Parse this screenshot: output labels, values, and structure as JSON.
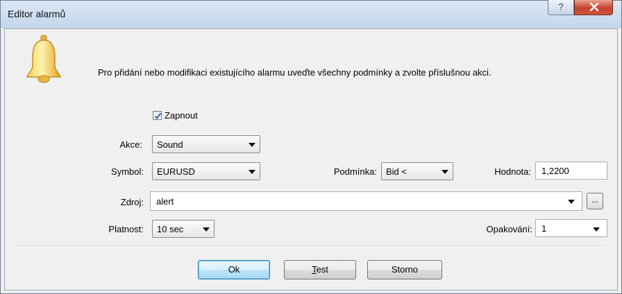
{
  "window": {
    "title": "Editor alarmů",
    "help_label": "?",
    "close_icon": "close-icon"
  },
  "icon": "bell-icon",
  "instructions": "Pro přidání nebo modifikaci existujícího alarmu uveďte všechny podmínky a zvolte příslušnou akci.",
  "enable": {
    "label": "Zapnout",
    "checked": true
  },
  "action": {
    "label": "Akce:",
    "value": "Sound"
  },
  "symbol": {
    "label": "Symbol:",
    "value": "EURUSD"
  },
  "condition": {
    "label": "Podmínka:",
    "value": "Bid <"
  },
  "value": {
    "label": "Hodnota:",
    "value": "1,2200"
  },
  "source": {
    "label": "Zdroj:",
    "value": "alert",
    "browse_label": "..."
  },
  "expiration": {
    "label": "Platnost:",
    "value": "10 sec"
  },
  "repeat": {
    "label": "Opakování:",
    "value": "1"
  },
  "buttons": {
    "ok": "Ok",
    "test_underlined": "T",
    "test_rest": "est",
    "cancel": "Storno"
  }
}
